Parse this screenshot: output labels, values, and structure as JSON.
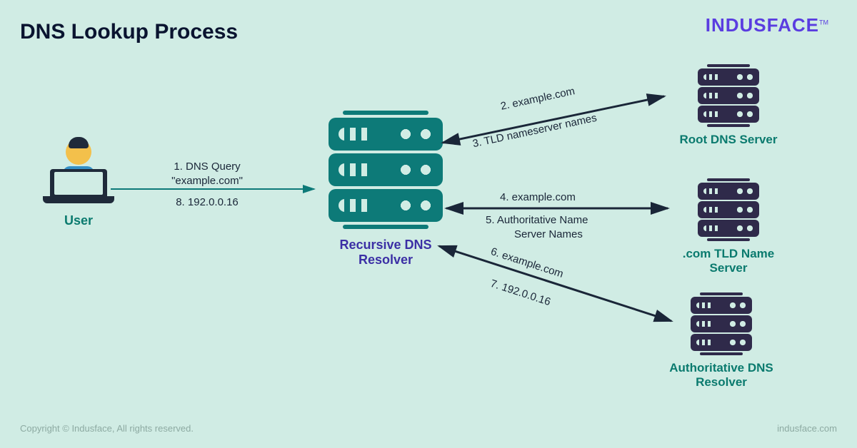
{
  "title": "DNS Lookup Process",
  "brand": "INDUSFACE",
  "trademark": "TM",
  "copyright": "Copyright © Indusface, All rights reserved.",
  "website": "indusface.com",
  "nodes": {
    "user": "User",
    "resolver": "Recursive DNS Resolver",
    "root": "Root DNS Server",
    "tld": ".com TLD  Name Server",
    "auth": "Authoritative DNS Resolver"
  },
  "steps": {
    "s1a": "1. DNS Query",
    "s1b": "\"example.com\"",
    "s2": "2. example.com",
    "s3": "3. TLD nameserver names",
    "s4": "4. example.com",
    "s5a": "5. Authoritative Name",
    "s5b": "Server Names",
    "s6": "6. example.com",
    "s7": "7. 192.0.0.16",
    "s8": "8. 192.0.0.16"
  }
}
